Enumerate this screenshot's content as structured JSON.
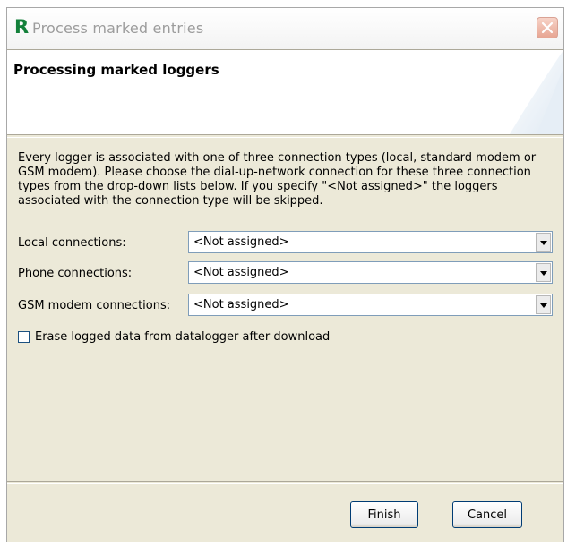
{
  "window": {
    "app_logo": "R",
    "title": "Process marked entries"
  },
  "header": {
    "title": "Processing marked loggers"
  },
  "description": "Every logger is associated with one of three connection types (local, standard modem or GSM modem). Please choose the dial-up-network connection for these three connection types from the drop-down lists below. If you specify \"<Not assigned>\" the loggers associated with the connection type will be skipped.",
  "connections": [
    {
      "label": "Local connections:",
      "value": "<Not assigned>"
    },
    {
      "label": "Phone connections:",
      "value": "<Not assigned>"
    },
    {
      "label": "GSM modem connections:",
      "value": "<Not assigned>"
    }
  ],
  "erase_option": {
    "label": "Erase logged data from datalogger after download",
    "checked": false
  },
  "buttons": {
    "finish": "Finish",
    "cancel": "Cancel"
  },
  "colors": {
    "dialog_bg": "#ece9d8",
    "logo": "#13803a",
    "close_button": "#e7a592",
    "field_border": "#7f9db9"
  },
  "icons": [
    "app-logo",
    "close-icon",
    "dropdown-arrow-icon"
  ]
}
